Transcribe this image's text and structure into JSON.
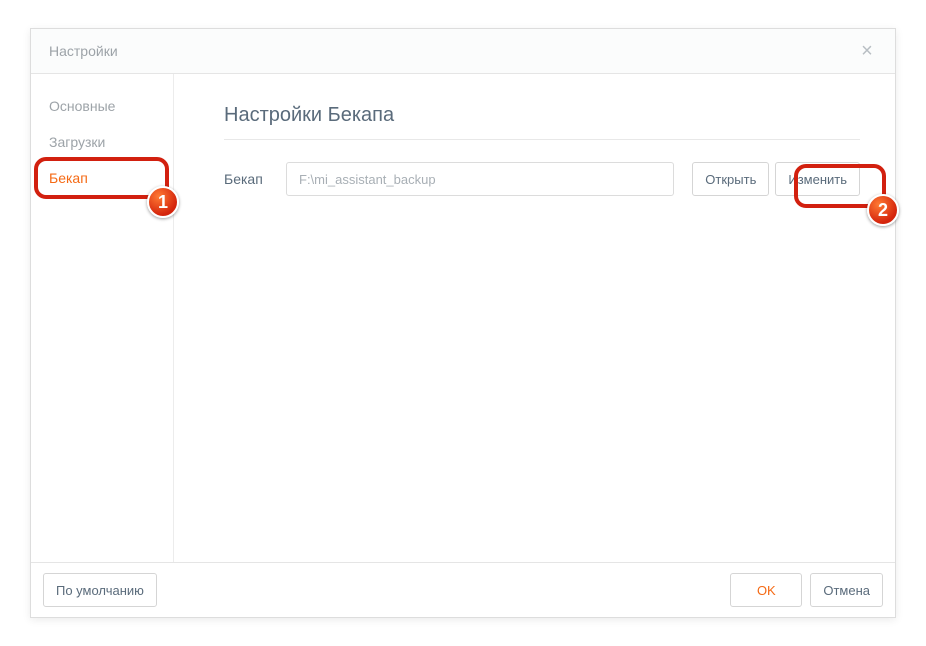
{
  "window": {
    "title": "Настройки"
  },
  "sidebar": {
    "items": [
      {
        "label": "Основные",
        "active": false
      },
      {
        "label": "Загрузки",
        "active": false
      },
      {
        "label": "Бекап",
        "active": true
      }
    ]
  },
  "content": {
    "heading": "Настройки Бекапа",
    "backup": {
      "label": "Бекап",
      "path": "F:\\mi_assistant_backup",
      "open_label": "Открыть",
      "change_label": "Изменить"
    }
  },
  "footer": {
    "default_label": "По умолчанию",
    "ok_label": "OK",
    "cancel_label": "Отмена"
  },
  "annotations": {
    "badge1": "1",
    "badge2": "2"
  }
}
